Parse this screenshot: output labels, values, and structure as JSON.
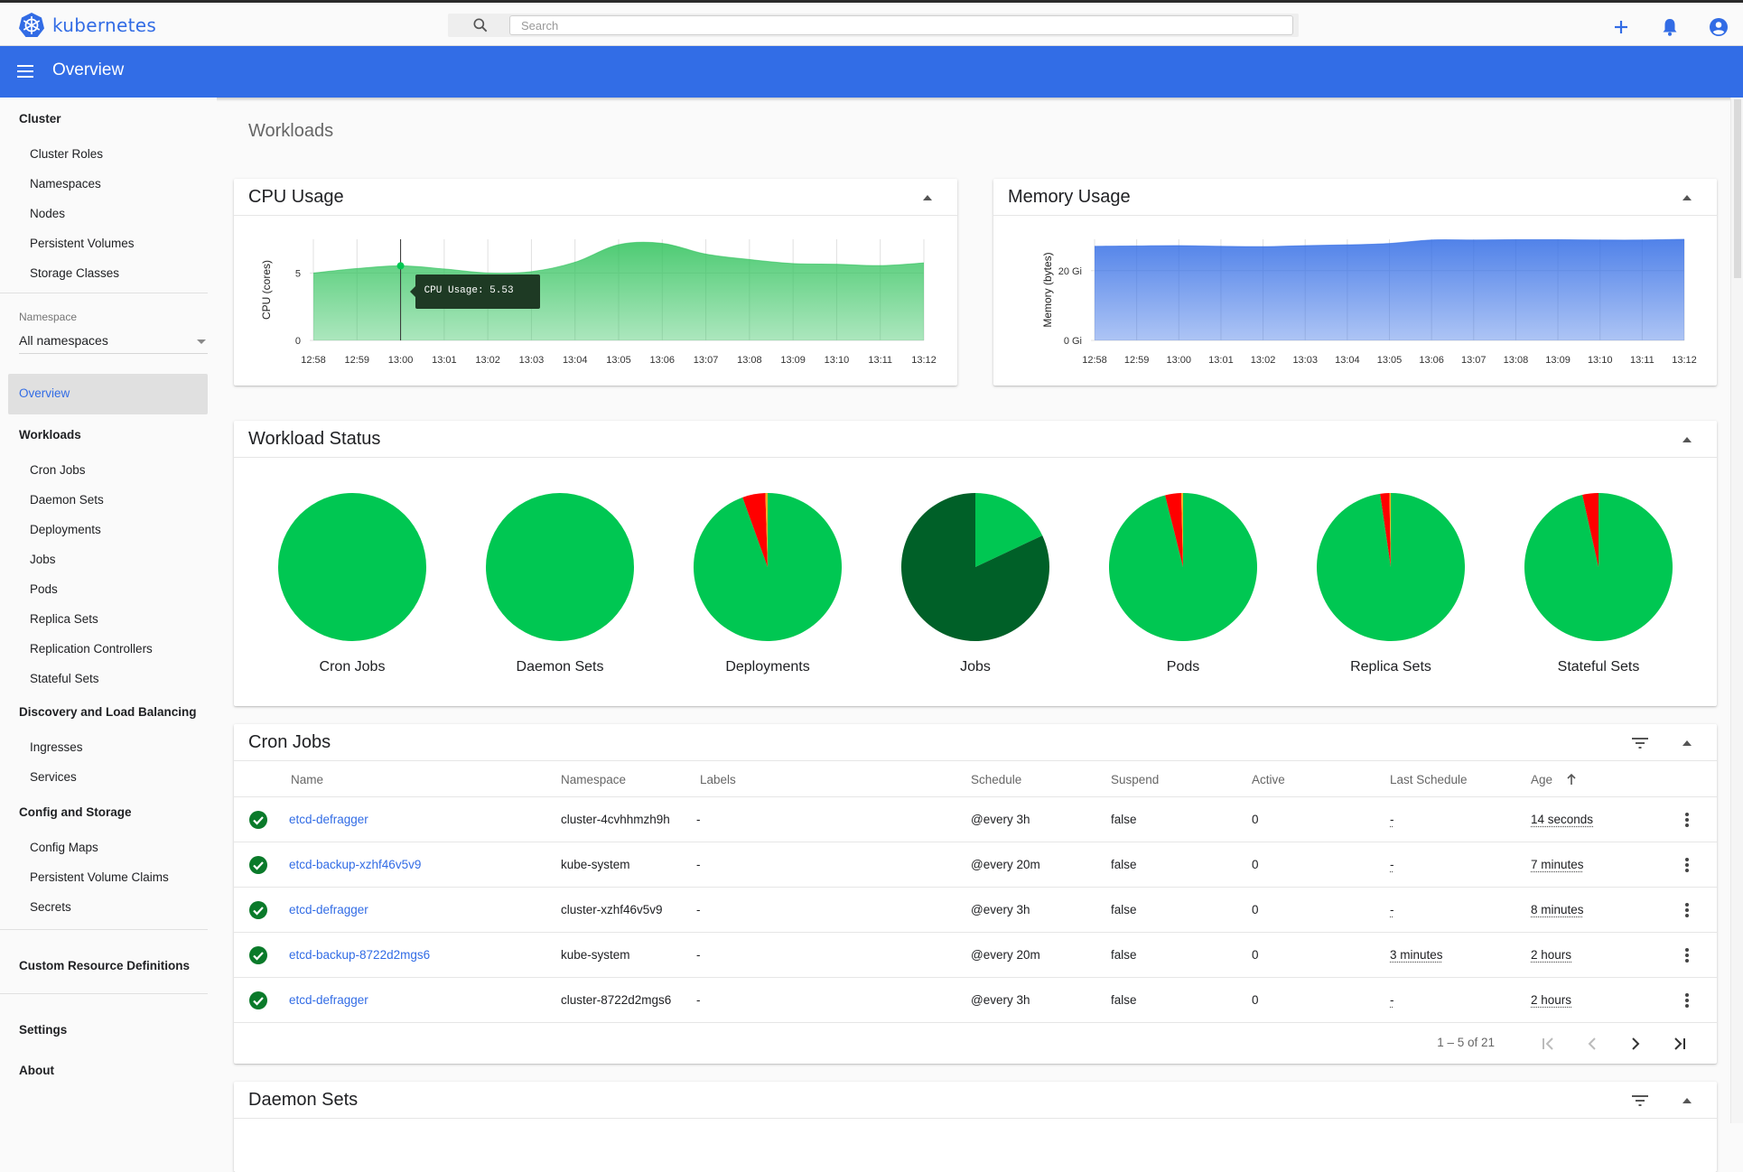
{
  "app": {
    "brand": "kubernetes",
    "brand_color": "#326ce5",
    "toolbar_color": "#326de6",
    "toolbar_title": "Overview"
  },
  "search": {
    "placeholder": "Search",
    "value": ""
  },
  "top_actions": [
    {
      "icon": "plus-icon",
      "label": "Create"
    },
    {
      "icon": "bell-icon",
      "label": "Notifications"
    },
    {
      "icon": "account-icon",
      "label": "Account"
    }
  ],
  "sidebar": {
    "cluster": {
      "heading": "Cluster",
      "items": [
        "Cluster Roles",
        "Namespaces",
        "Nodes",
        "Persistent Volumes",
        "Storage Classes"
      ]
    },
    "namespace": {
      "label": "Namespace",
      "selected": "All namespaces"
    },
    "active_item": "Overview",
    "workloads": {
      "heading": "Workloads",
      "items": [
        "Cron Jobs",
        "Daemon Sets",
        "Deployments",
        "Jobs",
        "Pods",
        "Replica Sets",
        "Replication Controllers",
        "Stateful Sets"
      ]
    },
    "discovery": {
      "heading": "Discovery and Load Balancing",
      "items": [
        "Ingresses",
        "Services"
      ]
    },
    "config": {
      "heading": "Config and Storage",
      "items": [
        "Config Maps",
        "Persistent Volume Claims",
        "Secrets"
      ]
    },
    "crd": "Custom Resource Definitions",
    "settings": "Settings",
    "about": "About"
  },
  "main": {
    "section_title": "Workloads",
    "cpu_card_title": "CPU Usage",
    "memory_card_title": "Memory Usage",
    "workload_status_title": "Workload Status",
    "cron_jobs_title": "Cron Jobs",
    "daemon_sets_title": "Daemon Sets"
  },
  "chart_data": [
    {
      "type": "area",
      "title": "CPU Usage",
      "xlabel": "",
      "ylabel": "CPU (cores)",
      "x": [
        "12:58",
        "12:59",
        "13:00",
        "13:01",
        "13:02",
        "13:03",
        "13:04",
        "13:05",
        "13:06",
        "13:07",
        "13:08",
        "13:09",
        "13:10",
        "13:11",
        "13:12"
      ],
      "values": [
        5.0,
        5.33,
        5.53,
        5.3,
        5.0,
        5.1,
        5.8,
        7.1,
        7.2,
        6.4,
        6.0,
        5.7,
        5.65,
        5.55,
        5.75
      ],
      "yticks": [
        0,
        5
      ],
      "ylim": [
        0,
        7.5
      ],
      "color": "#2fc25b",
      "grid": true,
      "tooltip": {
        "x": "13:00",
        "text": "CPU Usage: 5.53"
      }
    },
    {
      "type": "area",
      "title": "Memory Usage",
      "xlabel": "",
      "ylabel": "Memory (bytes)",
      "x": [
        "12:58",
        "12:59",
        "13:00",
        "13:01",
        "13:02",
        "13:03",
        "13:04",
        "13:05",
        "13:06",
        "13:07",
        "13:08",
        "13:09",
        "13:10",
        "13:11",
        "13:12"
      ],
      "values": [
        27.0,
        27.1,
        27.2,
        27.0,
        26.9,
        27.2,
        27.4,
        27.8,
        28.8,
        28.8,
        28.9,
        28.9,
        28.8,
        28.8,
        29.0
      ],
      "unit": "Gi",
      "yticks": [
        0,
        20
      ],
      "ytick_labels": [
        "0 Gi",
        "20 Gi"
      ],
      "ylim": [
        0,
        29
      ],
      "color": "#326ce5",
      "grid": true
    },
    {
      "type": "pie",
      "title": "Workload Status",
      "colors": {
        "running": "#00c752",
        "failed": "#ff0000",
        "pending": "#ffad20",
        "succeeded": "#006028"
      },
      "pies": [
        {
          "label": "Cron Jobs",
          "slices": [
            {
              "name": "running",
              "value": 100
            }
          ]
        },
        {
          "label": "Daemon Sets",
          "slices": [
            {
              "name": "running",
              "value": 100
            }
          ]
        },
        {
          "label": "Deployments",
          "slices": [
            {
              "name": "running",
              "value": 94.5
            },
            {
              "name": "failed",
              "value": 5.0
            },
            {
              "name": "pending",
              "value": 0.5
            }
          ]
        },
        {
          "label": "Jobs",
          "slices": [
            {
              "name": "running",
              "value": 18
            },
            {
              "name": "succeeded",
              "value": 82
            }
          ]
        },
        {
          "label": "Pods",
          "slices": [
            {
              "name": "running",
              "value": 96.1
            },
            {
              "name": "failed",
              "value": 3.5
            },
            {
              "name": "pending",
              "value": 0.4
            }
          ]
        },
        {
          "label": "Replica Sets",
          "slices": [
            {
              "name": "running",
              "value": 97.7
            },
            {
              "name": "failed",
              "value": 2.0
            },
            {
              "name": "pending",
              "value": 0.3
            }
          ]
        },
        {
          "label": "Stateful Sets",
          "slices": [
            {
              "name": "running",
              "value": 96.5
            },
            {
              "name": "failed",
              "value": 3.5
            }
          ]
        }
      ]
    }
  ],
  "cron_jobs": {
    "columns": [
      "Name",
      "Namespace",
      "Labels",
      "Schedule",
      "Suspend",
      "Active",
      "Last Schedule",
      "Age"
    ],
    "sort_column": "Age",
    "sort_direction": "ascending",
    "rows": [
      {
        "status": "success",
        "name": "etcd-defragger",
        "namespace": "cluster-4cvhhmzh9h",
        "labels": "-",
        "schedule": "@every 3h",
        "suspend": "false",
        "active": "0",
        "last_schedule": "-",
        "age": "14 seconds"
      },
      {
        "status": "success",
        "name": "etcd-backup-xzhf46v5v9",
        "namespace": "kube-system",
        "labels": "-",
        "schedule": "@every 20m",
        "suspend": "false",
        "active": "0",
        "last_schedule": "-",
        "age": "7 minutes"
      },
      {
        "status": "success",
        "name": "etcd-defragger",
        "namespace": "cluster-xzhf46v5v9",
        "labels": "-",
        "schedule": "@every 3h",
        "suspend": "false",
        "active": "0",
        "last_schedule": "-",
        "age": "8 minutes"
      },
      {
        "status": "success",
        "name": "etcd-backup-8722d2mgs6",
        "namespace": "kube-system",
        "labels": "-",
        "schedule": "@every 20m",
        "suspend": "false",
        "active": "0",
        "last_schedule": "3 minutes",
        "age": "2 hours"
      },
      {
        "status": "success",
        "name": "etcd-defragger",
        "namespace": "cluster-8722d2mgs6",
        "labels": "-",
        "schedule": "@every 3h",
        "suspend": "false",
        "active": "0",
        "last_schedule": "-",
        "age": "2 hours"
      }
    ],
    "pagination": "1 – 5 of 21",
    "status_color": "#0a7a2a",
    "link_color": "#326ce5"
  }
}
